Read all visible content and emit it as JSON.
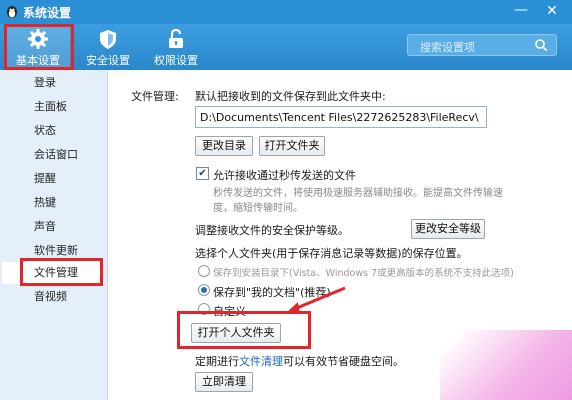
{
  "window": {
    "title": "系统设置",
    "minimize": "—",
    "close": "✕"
  },
  "toolbar": {
    "tabs": [
      {
        "label": "基本设置",
        "icon": "gear-icon"
      },
      {
        "label": "安全设置",
        "icon": "shield-icon"
      },
      {
        "label": "权限设置",
        "icon": "lock-icon"
      }
    ],
    "search_placeholder": "搜索设置项"
  },
  "sidebar": {
    "items": [
      "登录",
      "主面板",
      "状态",
      "会话窗口",
      "提醒",
      "热键",
      "声音",
      "软件更新",
      "文件管理",
      "音视频"
    ],
    "active_index": 8
  },
  "file_management": {
    "section_label": "文件管理:",
    "default_save_text": "默认把接收到的文件保存到此文件夹中:",
    "path_value": "D:\\Documents\\Tencent Files\\2272625283\\FileRecv\\",
    "change_dir_button": "更改目录",
    "open_folder_button": "打开文件夹",
    "allow_fast_transfer": {
      "checked": true,
      "label": "允许接收通过秒传发送的文件"
    },
    "fast_transfer_desc_line1": "秒传发送的文件，将使用极速服务器辅助接收。能提高文件传输速",
    "fast_transfer_desc_line2": "度，缩短传输时间。",
    "security_level_text": "调整接收文件的安全保护等级。",
    "change_security_button": "更改安全等级",
    "personal_folder_text": "选择个人文件夹(用于保存消息记录等数据)的保存位置。",
    "radio_options": [
      {
        "label": "保存到安装目录下(Vista、Windows 7或更高版本的系统不支持此选项)",
        "selected": false,
        "disabled": true
      },
      {
        "label": "保存到\"我的文档\"(推荐)",
        "selected": true,
        "disabled": false
      },
      {
        "label": "自定义",
        "selected": false,
        "disabled": false
      }
    ],
    "open_personal_folder_button": "打开个人文件夹",
    "cleanup_prefix": "定期进行",
    "cleanup_link": "文件清理",
    "cleanup_suffix": "可以有效节省硬盘空间。",
    "clean_now_button": "立即清理"
  },
  "colors": {
    "titlebar": "#2a8fd4",
    "highlight": "#e0262b",
    "link": "#1a66c2",
    "sidebar": "#e4eff9"
  }
}
